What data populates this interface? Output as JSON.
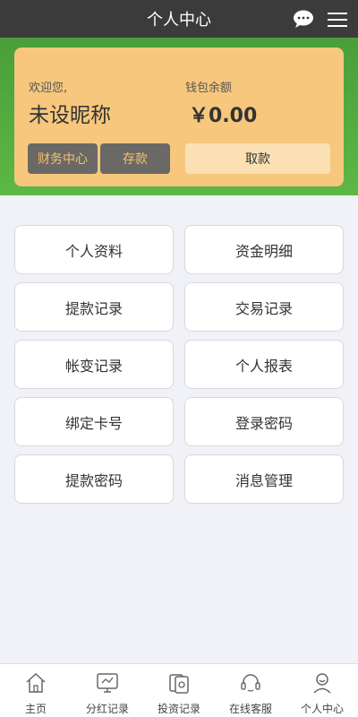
{
  "header": {
    "title": "个人中心",
    "chat_icon": "chat-bubble-icon",
    "menu_icon": "hamburger-menu-icon"
  },
  "account": {
    "welcome_label": "欢迎您,",
    "nickname": "未设昵称",
    "wallet_label": "钱包余额",
    "wallet_amount": "￥0.00"
  },
  "actions": {
    "finance": "财务中心",
    "deposit": "存款",
    "withdraw": "取款"
  },
  "menu": [
    "个人资料",
    "资金明细",
    "提款记录",
    "交易记录",
    "帐变记录",
    "个人报表",
    "绑定卡号",
    "登录密码",
    "提款密码",
    "消息管理"
  ],
  "tabs": [
    {
      "label": "主页",
      "icon": "home-icon"
    },
    {
      "label": "分红记录",
      "icon": "dividend-icon"
    },
    {
      "label": "投资记录",
      "icon": "investment-icon"
    },
    {
      "label": "在线客服",
      "icon": "customer-service-icon"
    },
    {
      "label": "个人中心",
      "icon": "user-icon"
    }
  ],
  "colors": {
    "topbar": "#3b3b3b",
    "green_band": "#5cb845",
    "card": "#f6c77d",
    "dark_button": "#6b6965",
    "dark_button_text": "#f5c06f",
    "withdraw_button": "#fbe0b4"
  }
}
